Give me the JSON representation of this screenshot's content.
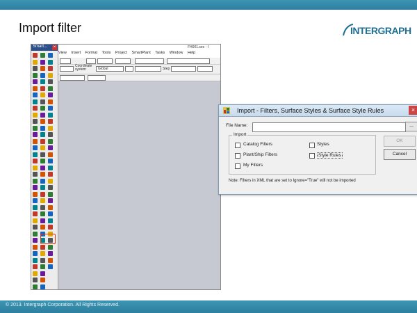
{
  "slide": {
    "title": "Import  filter",
    "logo_text": "INTERGRAPH",
    "footer": "© 2013. Intergraph Corporation. All Rights Reserved.",
    "colors": {
      "band": "#2d7f9f",
      "accent": "#1f6f92"
    }
  },
  "app": {
    "palette_title": "Smart...",
    "window_title": "FH001.ses - I",
    "menu": [
      "View",
      "Insert",
      "Format",
      "Tools",
      "Project",
      "SmartPlant",
      "Tasks",
      "Window",
      "Help"
    ],
    "coord_label": "Coordinate system",
    "coord_value": "Global",
    "step_label": "Step"
  },
  "dialog": {
    "title": "Import - Filters, Surface Styles & Surface Style Rules",
    "file_name_label": "File Name:",
    "file_name_value": "",
    "browse_label": "...",
    "group_label": "Import",
    "checkboxes": [
      {
        "label": "Catalog Filters",
        "checked": false
      },
      {
        "label": "Plant/Ship Filters",
        "checked": false
      },
      {
        "label": "My Filters",
        "checked": false
      },
      {
        "label": "Styles",
        "checked": false
      },
      {
        "label": "Style Rules",
        "checked": false
      }
    ],
    "ok_label": "OK",
    "cancel_label": "Cancel",
    "note": "Note: Filters in XML that are set to Ignore=\"True\" will not be imported"
  }
}
